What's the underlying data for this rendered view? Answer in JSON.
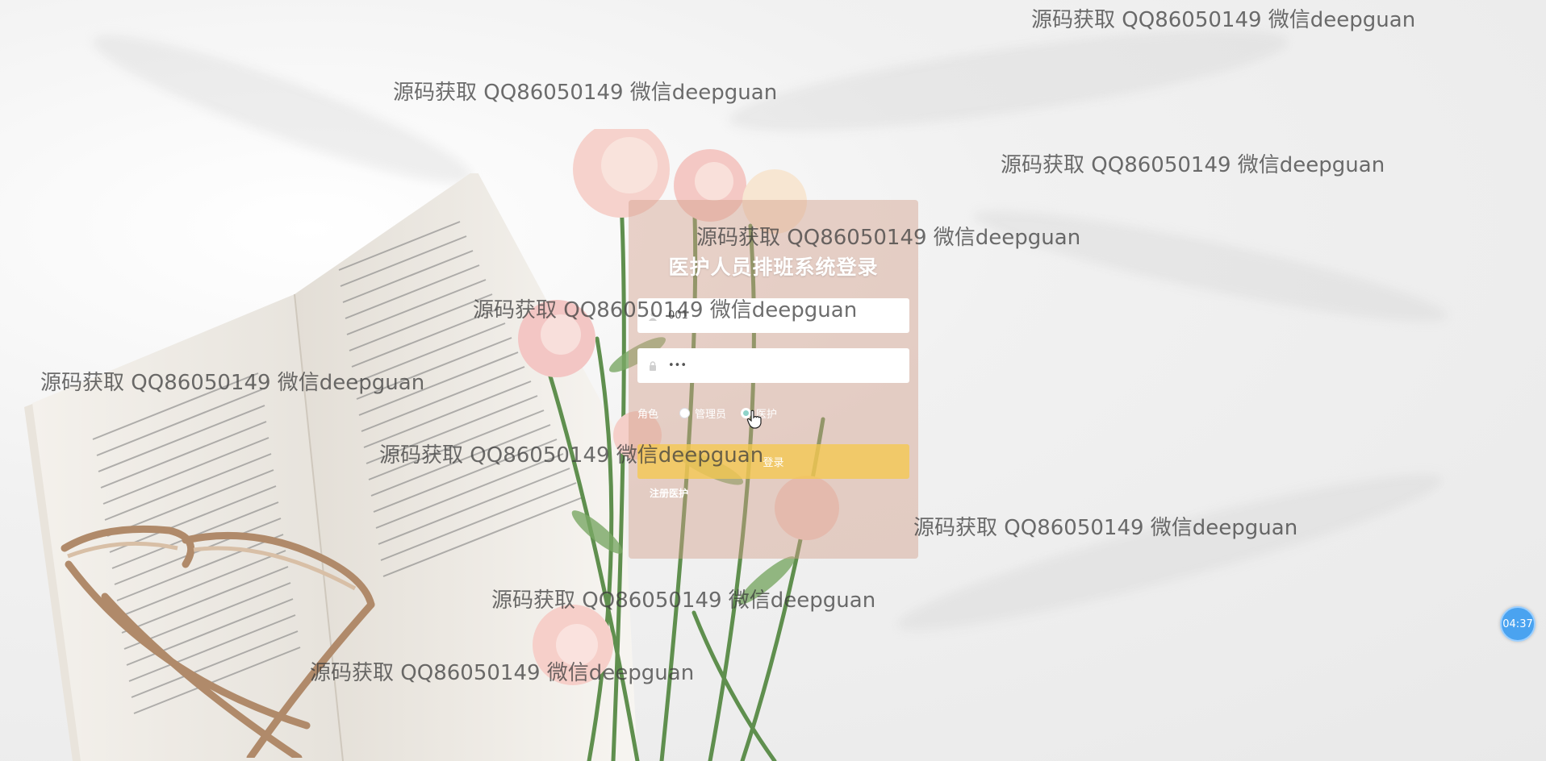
{
  "login": {
    "title": "医护人员排班系统登录",
    "username_value": "001",
    "password_value": "•••",
    "role_label": "角色",
    "roles": [
      {
        "label": "管理员",
        "selected": false
      },
      {
        "label": "医护",
        "selected": true
      }
    ],
    "login_button": "登录",
    "register_link": "注册医护"
  },
  "watermark_text": "源码获取 QQ86050149 微信deepguan",
  "timer": "04:37",
  "colors": {
    "panel": "#d2a08c",
    "button": "#f5c850",
    "timer": "#4aa3f0"
  },
  "icons": {
    "username": "user-icon",
    "password": "lock-icon"
  }
}
